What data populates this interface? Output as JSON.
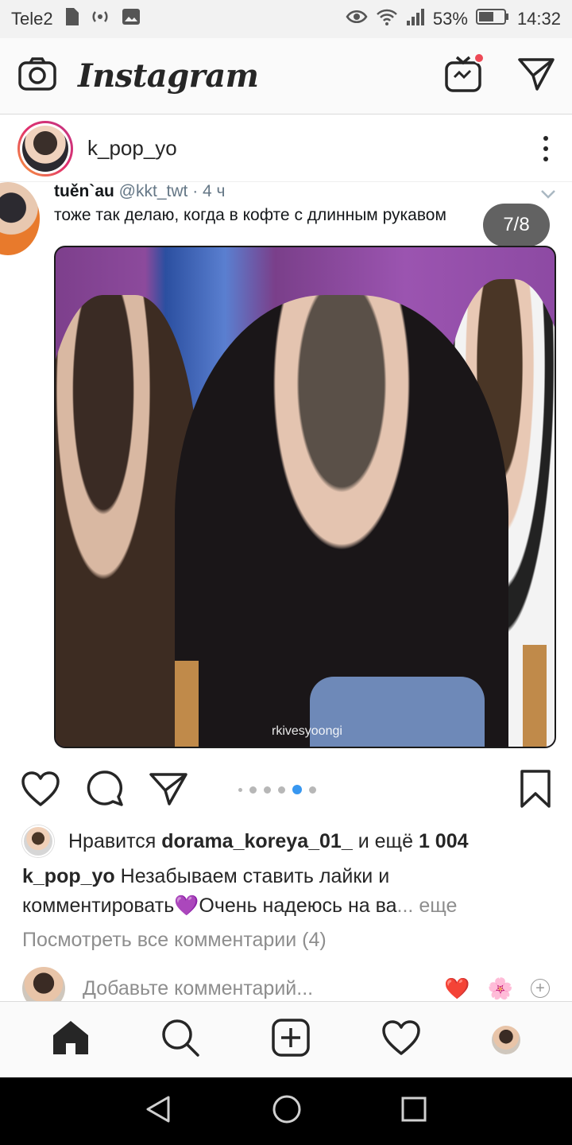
{
  "status_bar": {
    "carrier": "Tele2",
    "battery": "53%",
    "time": "14:32"
  },
  "app_header": {
    "logo": "Instagram"
  },
  "post": {
    "username": "k_pop_yo",
    "tweet": {
      "display_name": "tuěn`au",
      "handle": "@kkt_twt",
      "time": "4 ч",
      "text": "тоже так делаю, когда в кофте с длинным рукавом"
    },
    "media_counter": "7/8",
    "watermark": "rkivesyoongi",
    "carousel": {
      "total": 8,
      "active_index": 7
    },
    "likes": {
      "prefix": "Нравится",
      "user": "dorama_koreya_01_",
      "middle": "и ещё",
      "count": "1 004"
    },
    "caption": {
      "user": "k_pop_yo",
      "text": "Незабываем ставить лайки и комментировать💜Очень надеюсь на ва",
      "ellipsis": "...",
      "more": "еще"
    },
    "view_comments": "Посмотреть все комментарии (4)",
    "add_comment_placeholder": "Добавьте комментарий...",
    "quick_reactions": [
      "❤️",
      "🌸"
    ]
  },
  "colors": {
    "accent": "#3897f0",
    "notification": "#ed4956",
    "secondary_text": "#8e8e8e"
  }
}
